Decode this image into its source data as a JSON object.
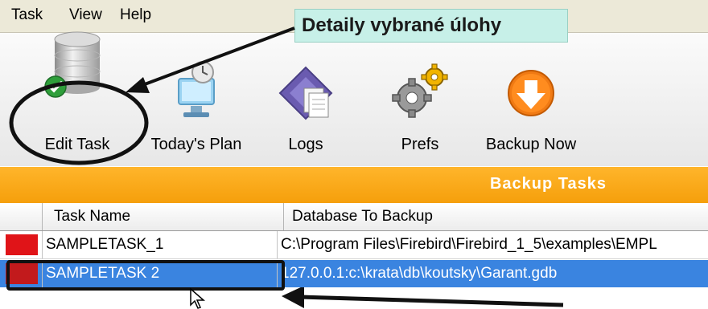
{
  "menu": {
    "task": "Task",
    "view": "View",
    "help": "Help"
  },
  "callout": {
    "text": "Detaily vybrané úlohy"
  },
  "toolbar": {
    "edit_task": "Edit Task",
    "todays_plan": "Today's Plan",
    "logs": "Logs",
    "prefs": "Prefs",
    "backup_now": "Backup Now"
  },
  "banner": {
    "title": "Backup Tasks"
  },
  "table": {
    "headers": {
      "task_name": "Task Name",
      "database": "Database To Backup"
    },
    "rows": [
      {
        "task_name": "SAMPLETASK_1",
        "database": "C:\\Program Files\\Firebird\\Firebird_1_5\\examples\\EMPL"
      },
      {
        "task_name": "SAMPLETASK 2",
        "database": "127.0.0.1:c:\\krata\\db\\koutsky\\Garant.gdb"
      }
    ]
  },
  "colors": {
    "banner": "#f59f0b",
    "status_red": "#e01418",
    "selection_blue": "#3a84e0",
    "callout_bg": "#c7f0e8"
  }
}
